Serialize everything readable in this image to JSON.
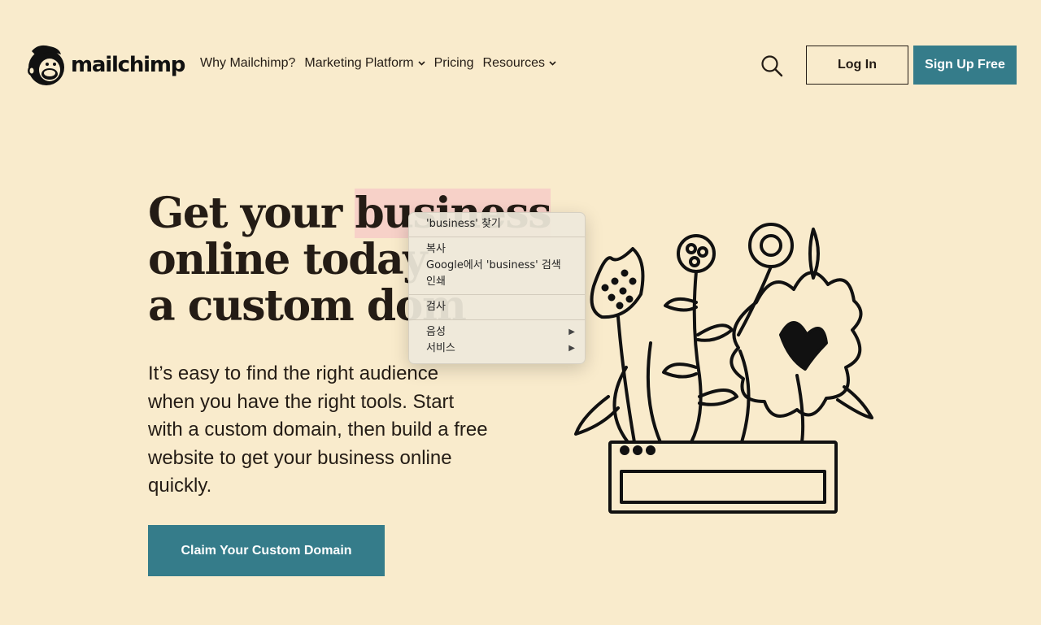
{
  "header": {
    "logo_text": "mailchimp",
    "nav": [
      {
        "label": "Why Mailchimp?",
        "has_dropdown": false
      },
      {
        "label": "Marketing Platform",
        "has_dropdown": true
      },
      {
        "label": "Pricing",
        "has_dropdown": false
      },
      {
        "label": "Resources",
        "has_dropdown": true
      }
    ],
    "search_icon": "search-icon",
    "login_label": "Log In",
    "signup_label": "Sign Up Free"
  },
  "hero": {
    "title_lines": [
      "Get your ",
      "business",
      "online today",
      "a custom dom"
    ],
    "description": "It’s easy to find the right audience when you have the right tools. Start with a custom domain, then build a free website to get your business online quickly.",
    "cta_label": "Claim Your Custom Domain"
  },
  "context_menu": {
    "items": [
      {
        "label": "'business' 찾기",
        "group": 1
      },
      {
        "label": "복사",
        "group": 2
      },
      {
        "label": "Google에서 'business' 검색",
        "group": 2
      },
      {
        "label": "인쇄",
        "group": 2
      },
      {
        "label": "검사",
        "group": 3
      },
      {
        "label": "음성",
        "group": 4,
        "submenu": true
      },
      {
        "label": "서비스",
        "group": 4,
        "submenu": true
      }
    ]
  },
  "colors": {
    "background": "#f9ebcc",
    "accent": "#357c8a",
    "text": "#241c15",
    "highlight": "#f7d1c8"
  }
}
